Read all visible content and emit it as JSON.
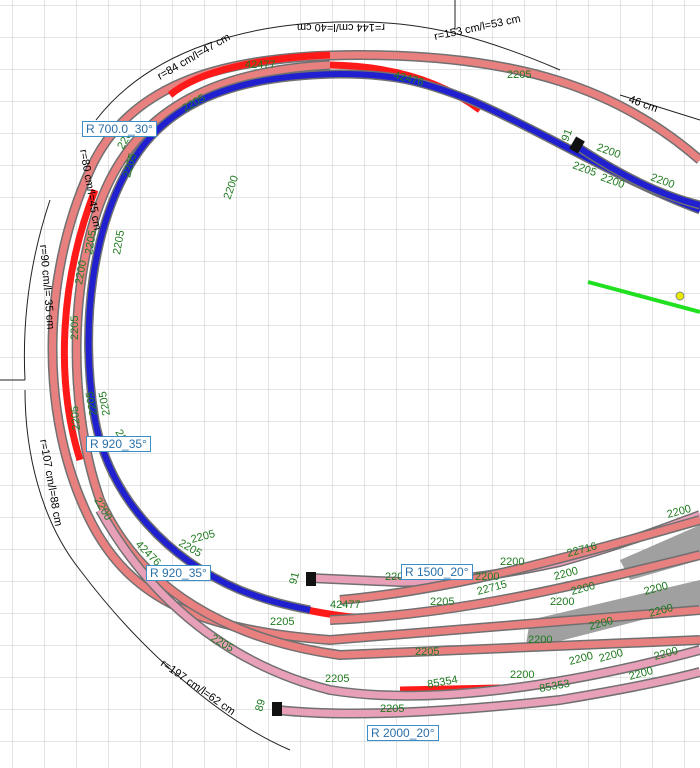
{
  "radius_labels": [
    "R 700.0_30°",
    "R 920_35°",
    "R 920_35°",
    "R 1500_20°",
    "R 2000_20°"
  ],
  "dimensions": {
    "d_r84": "r=84 cm/l=47 cm",
    "d_r144": "r=144 cm/l=40 cm",
    "d_r153": "r=153 cm/l=53 cm",
    "d_46": "46 cm",
    "d_r80": "r=80 cm/l=45 cm",
    "d_r90": "r=90 cm/l= 35 cm",
    "d_r107": "r=107 cm/l=88 cm",
    "d_r197": "r=197 cm/l=62 cm"
  },
  "track_labels": {
    "t_42477_top": "42477",
    "t_42476_top": "42476",
    "t_2205_topright": "2205",
    "t_2205_topleft": "2205",
    "t_2205_a": "2205",
    "t_2205_b": "2205",
    "t_91_top": "91",
    "t_2200_tr1": "2200",
    "t_2205_tr": "2205",
    "t_2200_tr2": "2200",
    "t_2200_left1": "2200",
    "t_2205_left2": "2205",
    "t_2205_left3": "2205",
    "t_2205_left4": "2205",
    "t_2205_left5": "2205",
    "t_2200_left6": "2200",
    "t_2200_mid": "2200",
    "t_2205_bl": "2205",
    "t_42476_bl": "42476",
    "t_2205_bl2": "2205",
    "t_91_bottom": "91",
    "t_2205_b1": "2205",
    "t_42477_b": "42477",
    "t_2205_b2": "2205",
    "t_2200_b3": "2200",
    "t_22716": "22716",
    "t_22715": "22715",
    "t_2200_b4": "2200",
    "t_2200_b5": "2200",
    "t_2200_b6": "2200",
    "t_2205_b7": "2205",
    "t_2205_b8": "2205",
    "t_2205_b9": "2205",
    "t_2200_b10": "2200",
    "t_2200_b11": "2200",
    "t_2200_b12": "2200",
    "t_2200_b13": "2200",
    "t_2200_b14": "2200",
    "t_2205_b15": "2205",
    "t_85354": "85354",
    "t_85353": "85353",
    "t_2200_b16": "2200",
    "t_2200_b17": "2200",
    "t_2205_b18": "2205",
    "t_89": "89",
    "t_2205_b19": "2205",
    "t_2200_b20": "2200",
    "t_2205_b21": "2205",
    "t_2200_b22": "2200",
    "t_2200_b23": "2200",
    "t_2200_b24": "2200",
    "t_2200_b25": "2200",
    "t_2200_b26": "2200"
  },
  "colors": {
    "grid": "#c8c8c8",
    "track_pink": "#e8a0b8",
    "track_salmon": "#e88080",
    "track_red": "#ff1a1a",
    "track_blue": "#2020d0",
    "track_outline": "#707070",
    "platform": "#a0a0a0",
    "marker_green": "#20e020",
    "label_green": "#1f7a1f",
    "box_border": "#3a8fc8",
    "box_text": "#2a6fa8"
  }
}
